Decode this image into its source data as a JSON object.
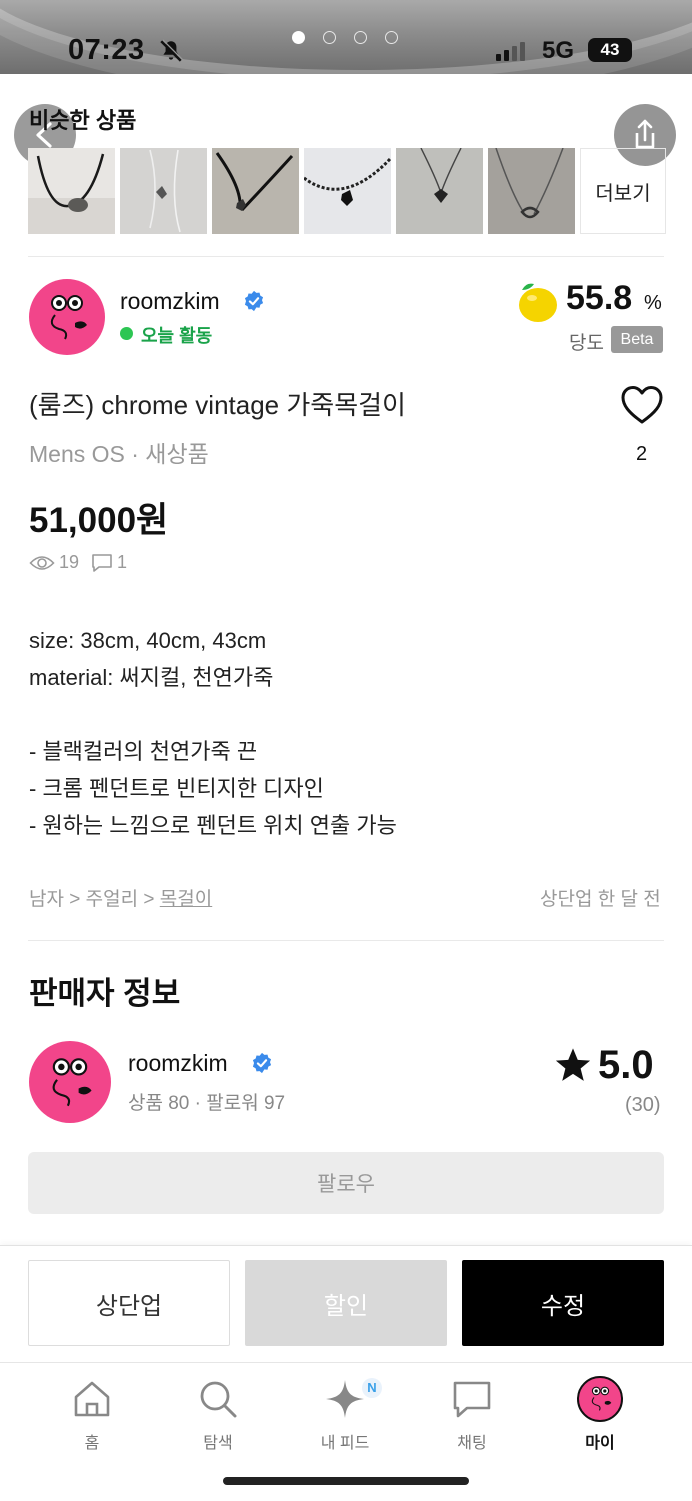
{
  "status_bar": {
    "time": "07:23",
    "network": "5G",
    "battery": "43"
  },
  "carousel": {
    "page_count": 4,
    "active_page": 1
  },
  "similar": {
    "title": "비슷한 상품",
    "more_label": "더보기",
    "thumb_count": 6
  },
  "seller": {
    "name": "roomzkim",
    "activity": "오늘 활동",
    "sugar_value": "55.8",
    "sugar_unit": "%",
    "sugar_label": "당도",
    "beta": "Beta"
  },
  "product": {
    "title": "(룸즈) chrome vintage 가죽목걸이",
    "subtitle": "Mens OS · 새상품",
    "likes": "2",
    "price": "51,000원",
    "views": "19",
    "comments": "1",
    "description": [
      "size: 38cm, 40cm, 43cm",
      "material: 써지컬, 천연가죽",
      "",
      "- 블랙컬러의 천연가죽 끈",
      "- 크롬 펜던트로 빈티지한 디자인",
      "- 원하는 느낌으로 펜던트 위치 연출 가능"
    ],
    "breadcrumb_1": "남자",
    "breadcrumb_2": "주얼리",
    "breadcrumb_3": "목걸이",
    "breadcrumb_sep": ">",
    "updated": "상단업 한 달 전"
  },
  "seller_info": {
    "title": "판매자 정보",
    "name": "roomzkim",
    "meta": "상품 80 · 팔로워 97",
    "rating": "5.0",
    "rating_count": "(30)",
    "follow_label": "팔로우"
  },
  "actions": {
    "bump": "상단업",
    "discount": "할인",
    "edit": "수정"
  },
  "tabs": [
    {
      "label": "홈",
      "icon": "home-icon"
    },
    {
      "label": "탐색",
      "icon": "search-icon"
    },
    {
      "label": "내 피드",
      "icon": "sparkle-icon",
      "badge": "N"
    },
    {
      "label": "채팅",
      "icon": "chat-icon"
    },
    {
      "label": "마이",
      "icon": "avatar-icon"
    }
  ],
  "colors": {
    "accent_green": "#2dc653",
    "avatar_pink": "#f2458a",
    "verified_blue": "#3b8beb",
    "badge_blue": "#3aa0e8"
  }
}
